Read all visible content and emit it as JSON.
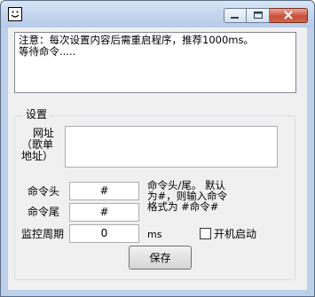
{
  "window": {
    "title": "",
    "icon": "smiley-face-icon",
    "controls": {
      "minimize": "minimize-icon",
      "maximize": "maximize-icon",
      "close": "close-icon"
    }
  },
  "log": {
    "line1": "注意：每次设置内容后需重启程序，推荐1000ms。",
    "line2": "等待命令....."
  },
  "settings": {
    "group_title": "设置",
    "url_label_line1": "网址",
    "url_label_line2": "（歌单",
    "url_label_line3": "地址）",
    "url_value": "",
    "cmd_head_label": "命令头",
    "cmd_head_value": "#",
    "cmd_tail_label": "命令尾",
    "cmd_tail_value": "#",
    "interval_label": "监控周期",
    "interval_value": "0",
    "interval_unit": "ms",
    "hint_line1": "命令头/尾。 默认",
    "hint_line2": "为#，则输入命令",
    "hint_line3": "格式为 #命令#",
    "autostart_label": "开机启动",
    "autostart_checked": false,
    "save_label": "保存"
  }
}
